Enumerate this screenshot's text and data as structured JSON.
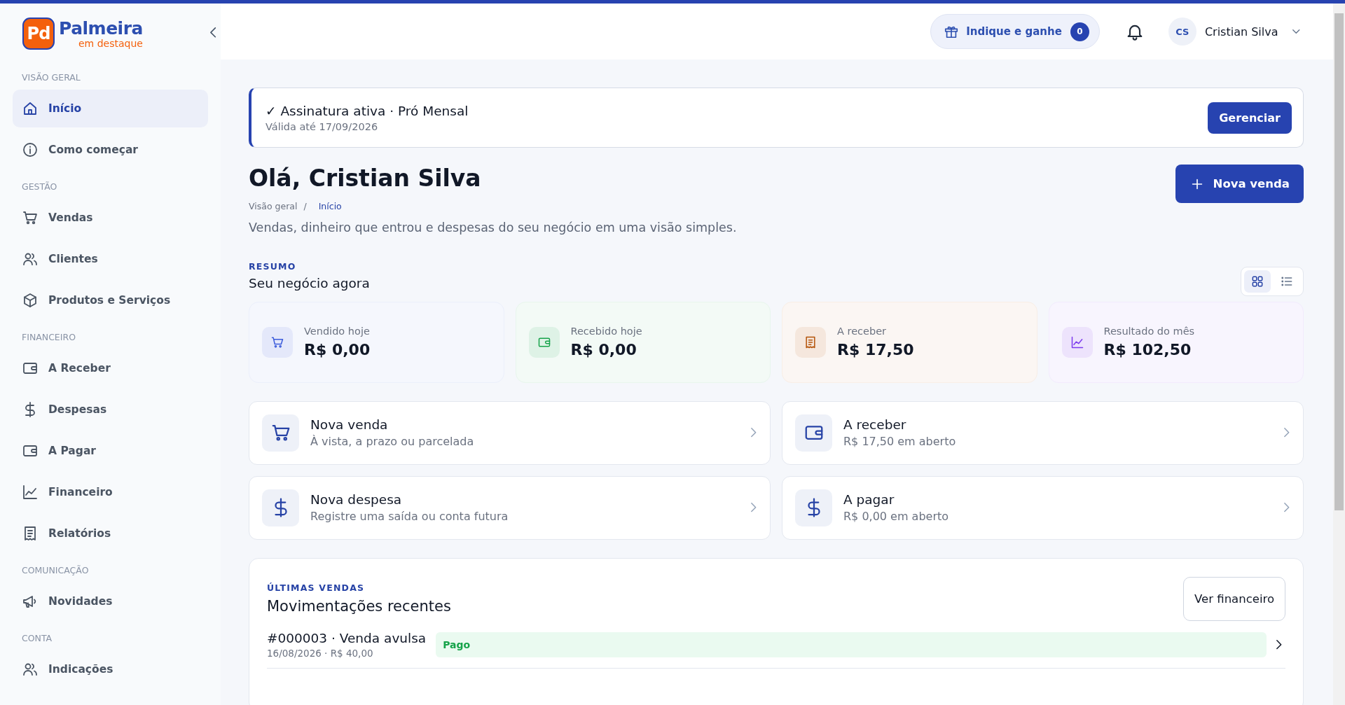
{
  "logo": {
    "mark": "Pd",
    "name": "Palmeira",
    "tagline": "em destaque"
  },
  "sidebar": {
    "sections": [
      {
        "title": "VISÃO GERAL",
        "items": [
          {
            "label": "Início",
            "selected": true
          },
          {
            "label": "Como começar",
            "selected": false
          }
        ]
      },
      {
        "title": "GESTÃO",
        "items": [
          {
            "label": "Vendas",
            "selected": false
          },
          {
            "label": "Clientes",
            "selected": false
          },
          {
            "label": "Produtos e Serviços",
            "selected": false
          }
        ]
      },
      {
        "title": "FINANCEIRO",
        "items": [
          {
            "label": "A Receber",
            "selected": false
          },
          {
            "label": "Despesas",
            "selected": false
          },
          {
            "label": "A Pagar",
            "selected": false
          },
          {
            "label": "Financeiro",
            "selected": false
          },
          {
            "label": "Relatórios",
            "selected": false
          }
        ]
      },
      {
        "title": "COMUNICAÇÃO",
        "items": [
          {
            "label": "Novidades",
            "selected": false
          }
        ]
      },
      {
        "title": "CONTA",
        "items": [
          {
            "label": "Indicações",
            "selected": false
          }
        ]
      }
    ]
  },
  "header": {
    "referral": {
      "label": "Indique e ganhe",
      "count": "0"
    },
    "user": {
      "initials": "CS",
      "name": "Cristian Silva"
    }
  },
  "subscription": {
    "title": "✓ Assinatura ativa · Pró Mensal",
    "validity": "Válida até 17/09/2026",
    "button": "Gerenciar"
  },
  "page": {
    "title": "Olá, Cristian Silva",
    "breadcrumb": {
      "separator": "/",
      "items": [
        {
          "label": "Visão geral",
          "selected": false
        },
        {
          "label": "Início",
          "selected": true
        }
      ]
    },
    "description": "Vendas, dinheiro que entrou e despesas do seu negócio em uma visão simples.",
    "new_sale_button": "Nova venda"
  },
  "summary": {
    "eyebrow": "RESUMO",
    "title": "Seu negócio agora",
    "views": [
      {
        "selected": true
      },
      {
        "selected": false
      }
    ],
    "stats": [
      {
        "label": "Vendido hoje",
        "value": "R$ 0,00",
        "color": "#3b5bdb"
      },
      {
        "label": "Recebido hoje",
        "value": "R$ 0,00",
        "color": "#16a34a"
      },
      {
        "label": "A receber",
        "value": "R$ 17,50",
        "color": "#b45309"
      },
      {
        "label": "Resultado do mês",
        "value": "R$ 102,50",
        "color": "#7c3aed"
      }
    ]
  },
  "actions": [
    {
      "title": "Nova venda",
      "subtitle": "À vista, a prazo ou parcelada"
    },
    {
      "title": "A receber",
      "subtitle": "R$ 17,50 em aberto"
    },
    {
      "title": "Nova despesa",
      "subtitle": "Registre uma saída ou conta futura"
    },
    {
      "title": "A pagar",
      "subtitle": "R$ 0,00 em aberto"
    }
  ],
  "recent": {
    "eyebrow": "ÚLTIMAS VENDAS",
    "title": "Movimentações recentes",
    "button": "Ver financeiro",
    "rows": [
      {
        "title": "#000003 · Venda avulsa",
        "meta": "16/08/2026 · R$ 40,00",
        "status": "Pago"
      }
    ]
  }
}
